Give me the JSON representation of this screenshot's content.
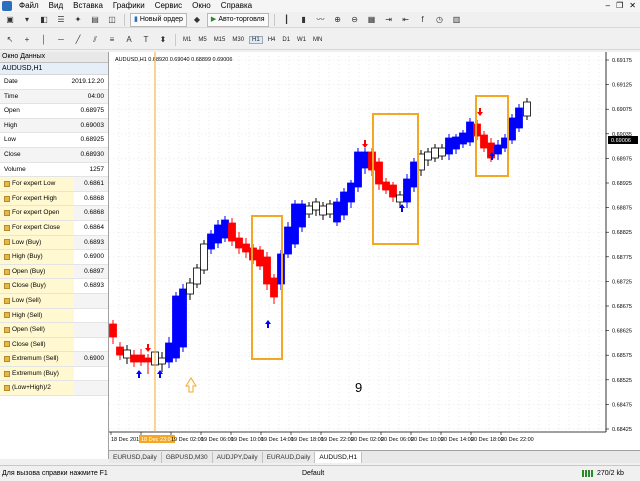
{
  "menu": {
    "items": [
      "Файл",
      "Вид",
      "Вставка",
      "Графики",
      "Сервис",
      "Окно",
      "Справка"
    ]
  },
  "toolbar": {
    "new_order_label": "Новый ордер",
    "autotrading_label": "Авто-торговля",
    "timeframes": [
      "M1",
      "M5",
      "M15",
      "M30",
      "H1",
      "H4",
      "D1",
      "W1",
      "MN"
    ],
    "active_timeframe": "H1"
  },
  "data_window": {
    "title": "Окно Данных",
    "symbol": "AUDUSD,H1",
    "rows": [
      {
        "label": "Date",
        "value": "2019.12.20",
        "icon": false
      },
      {
        "label": "Time",
        "value": "04:00",
        "icon": false
      },
      {
        "label": "Open",
        "value": "0.68975",
        "icon": false
      },
      {
        "label": "High",
        "value": "0.69003",
        "icon": false
      },
      {
        "label": "Low",
        "value": "0.68925",
        "icon": false
      },
      {
        "label": "Close",
        "value": "0.68930",
        "icon": false
      },
      {
        "label": "Volume",
        "value": "1257",
        "icon": false
      },
      {
        "label": "For expert Low",
        "value": "0.6861",
        "icon": true
      },
      {
        "label": "For expert High",
        "value": "0.6868",
        "icon": true
      },
      {
        "label": "For expert Open",
        "value": "0.6868",
        "icon": true
      },
      {
        "label": "For expert Close",
        "value": "0.6864",
        "icon": true
      },
      {
        "label": "Low (Buy)",
        "value": "0.6893",
        "icon": true
      },
      {
        "label": "High (Buy)",
        "value": "0.6900",
        "icon": true
      },
      {
        "label": "Open (Buy)",
        "value": "0.6897",
        "icon": true
      },
      {
        "label": "Close (Buy)",
        "value": "0.6893",
        "icon": true
      },
      {
        "label": "Low (Sell)",
        "value": "",
        "icon": true
      },
      {
        "label": "High (Sell)",
        "value": "",
        "icon": true
      },
      {
        "label": "Open (Sell)",
        "value": "",
        "icon": true
      },
      {
        "label": "Close (Sell)",
        "value": "",
        "icon": true
      },
      {
        "label": "Extremum (Sell)",
        "value": "0.6900",
        "icon": true
      },
      {
        "label": "Extremum (Buy)",
        "value": "",
        "icon": true
      },
      {
        "label": "(Low+High)/2",
        "value": "",
        "icon": true
      }
    ]
  },
  "chart": {
    "header": "AUDUSD,H1  0.68920 0.69040 0.68899 0.69006",
    "current_price": "0.69006",
    "annotation_number": "9",
    "colors": {
      "up": "#0000ff",
      "down": "#ff0000",
      "neutral": "#ffffff",
      "box": "#f5a623",
      "buy_arrow": "#0000ff",
      "sell_arrow": "#ff0000"
    },
    "price_labels": [
      "0.69175",
      "0.69125",
      "0.69075",
      "0.69035",
      "0.68975",
      "0.68925",
      "0.68875",
      "0.68825",
      "0.68775",
      "0.68725",
      "0.68675",
      "0.68625",
      "0.68575",
      "0.68525",
      "0.68475",
      "0.68425"
    ],
    "time_labels": [
      "18 Dec 2019",
      "18 Dec 23:00",
      "19 Dec 02:00",
      "19 Dec 06:00",
      "19 Dec 10:00",
      "19 Dec 14:00",
      "19 Dec 18:00",
      "19 Dec 22:00",
      "20 Dec 02:00",
      "20 Dec 06:00",
      "20 Dec 10:00",
      "20 Dec 14:00",
      "20 Dec 18:00",
      "20 Dec 22:00"
    ],
    "highlight_time": "18 Dec 23:00"
  },
  "tabs": {
    "items": [
      "EURUSD,Daily",
      "GBPUSD,M30",
      "AUDJPY,Daily",
      "EURAUD,Daily",
      "AUDUSD,H1"
    ],
    "active": "AUDUSD,H1"
  },
  "status": {
    "help_text": "Для вызова справки нажмите F1",
    "profile": "Default",
    "traffic": "270/2 kb"
  }
}
